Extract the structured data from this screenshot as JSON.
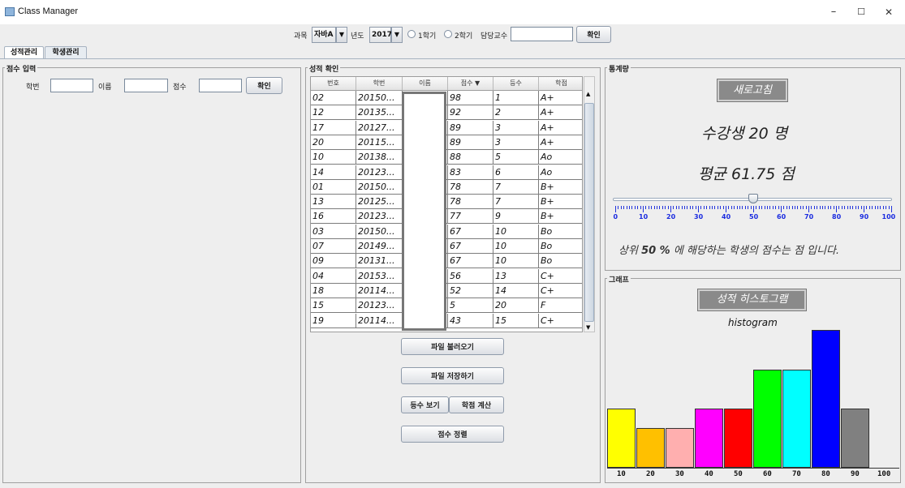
{
  "window": {
    "title": "Class Manager",
    "minimize": "–",
    "maximize": "☐",
    "close": "✕"
  },
  "toolbar": {
    "subject_label": "과목",
    "subject_value": "자바A",
    "year_label": "년도",
    "year_value": "2017",
    "semester1": "1학기",
    "semester2": "2학기",
    "professor_label": "담당교수",
    "professor_value": "",
    "confirm": "확인",
    "dropdown_arrow": "▼"
  },
  "tabs": [
    {
      "label": "성적관리",
      "active": true
    },
    {
      "label": "학생관리",
      "active": false
    }
  ],
  "score_input": {
    "title": "점수 입력",
    "student_id_label": "학번",
    "name_label": "이름",
    "score_label": "점수",
    "confirm": "확인"
  },
  "score_check": {
    "title": "성적 확인",
    "columns": [
      "번호",
      "학번",
      "이름",
      "점수 ▼",
      "등수",
      "학점"
    ],
    "rows": [
      [
        "02",
        "20150...",
        "",
        "98",
        "1",
        "A+"
      ],
      [
        "12",
        "20135...",
        "",
        "92",
        "2",
        "A+"
      ],
      [
        "17",
        "20127...",
        "",
        "89",
        "3",
        "A+"
      ],
      [
        "20",
        "20115...",
        "",
        "89",
        "3",
        "A+"
      ],
      [
        "10",
        "20138...",
        "",
        "88",
        "5",
        "Ao"
      ],
      [
        "14",
        "20123...",
        "",
        "83",
        "6",
        "Ao"
      ],
      [
        "01",
        "20150...",
        "",
        "78",
        "7",
        "B+"
      ],
      [
        "13",
        "20125...",
        "",
        "78",
        "7",
        "B+"
      ],
      [
        "16",
        "20123...",
        "",
        "77",
        "9",
        "B+"
      ],
      [
        "03",
        "20150...",
        "",
        "67",
        "10",
        "Bo"
      ],
      [
        "07",
        "20149...",
        "",
        "67",
        "10",
        "Bo"
      ],
      [
        "09",
        "20131...",
        "",
        "67",
        "10",
        "Bo"
      ],
      [
        "04",
        "20153...",
        "",
        "56",
        "13",
        "C+"
      ],
      [
        "18",
        "20114...",
        "",
        "52",
        "14",
        "C+"
      ],
      [
        "15",
        "20123...",
        "",
        "5",
        "20",
        "F"
      ],
      [
        "19",
        "20114...",
        "",
        "43",
        "15",
        "C+"
      ]
    ],
    "buttons": {
      "load": "파일 불러오기",
      "save": "파일 저장하기",
      "rank": "등수 보기",
      "grade": "학점 계산",
      "sort": "점수 정렬"
    }
  },
  "stats": {
    "title": "통계량",
    "refresh": "새로고침",
    "count_text": "수강생 20 명",
    "avg_text": "평균 61.75 점",
    "slider_value": 50,
    "slider_ticks": [
      "0",
      "10",
      "20",
      "30",
      "40",
      "50",
      "60",
      "70",
      "80",
      "90",
      "100"
    ],
    "percentile_pre": "상위 ",
    "percentile_value": "50 %",
    "percentile_post": " 에 해당하는 학생의 점수는    점 입니다."
  },
  "graph": {
    "title": "그래프",
    "button": "성적 히스토그램",
    "chart_title": "histogram"
  },
  "chart_data": {
    "type": "bar",
    "title": "histogram",
    "categories": [
      "10",
      "20",
      "30",
      "40",
      "50",
      "60",
      "70",
      "80",
      "90",
      "100"
    ],
    "values": [
      3,
      2,
      2,
      3,
      3,
      5,
      5,
      7,
      3,
      0
    ],
    "colors": [
      "#ffff00",
      "#ffc000",
      "#ffafaf",
      "#ff00ff",
      "#ff0000",
      "#00ff00",
      "#00ffff",
      "#0000ff",
      "#808080",
      "#ffffff"
    ],
    "ylim": [
      0,
      7
    ]
  }
}
